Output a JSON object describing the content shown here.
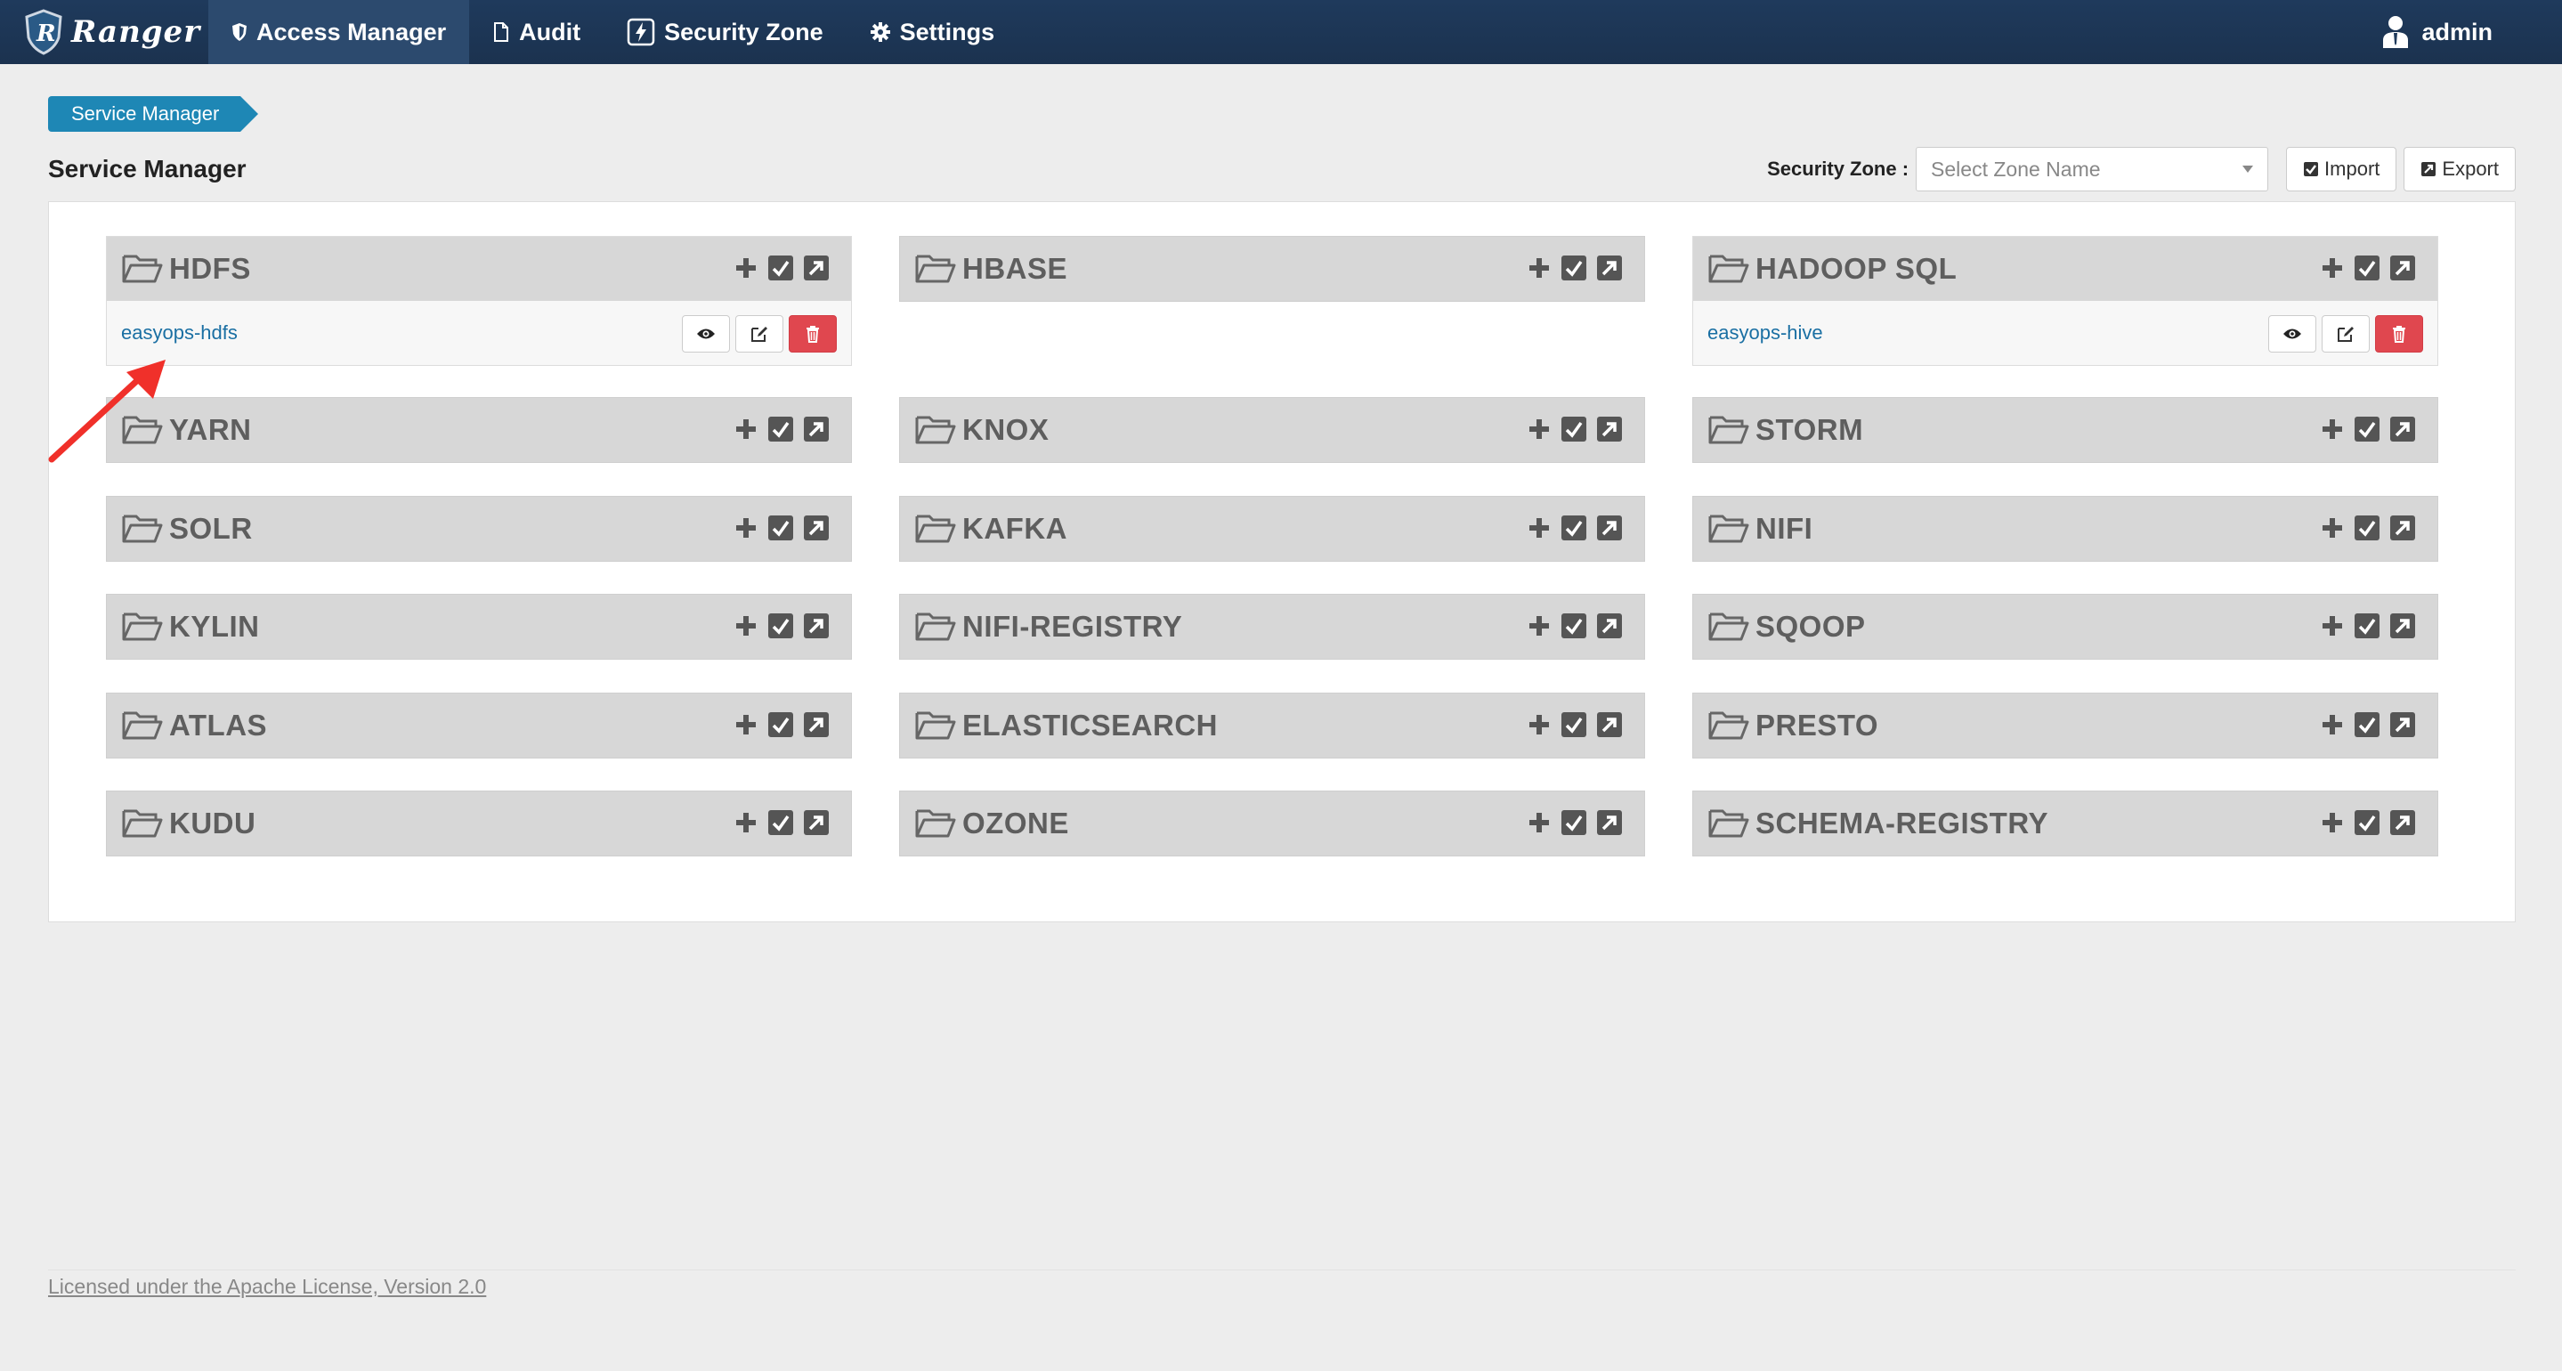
{
  "navbar": {
    "brand": "Ranger",
    "items": [
      {
        "label": "Access Manager",
        "icon": "shield-icon",
        "active": true
      },
      {
        "label": "Audit",
        "icon": "file-icon",
        "active": false
      },
      {
        "label": "Security Zone",
        "icon": "lightning-icon",
        "active": false
      },
      {
        "label": "Settings",
        "icon": "gear-icon",
        "active": false
      }
    ],
    "user": "admin"
  },
  "breadcrumb": [
    "Service Manager"
  ],
  "page": {
    "title": "Service Manager"
  },
  "toolbar": {
    "zone_label": "Security Zone :",
    "zone_placeholder": "Select Zone Name",
    "import_label": "Import",
    "export_label": "Export"
  },
  "services": [
    {
      "name": "HDFS",
      "items": [
        "easyops-hdfs"
      ]
    },
    {
      "name": "HBASE",
      "items": []
    },
    {
      "name": "HADOOP SQL",
      "items": [
        "easyops-hive"
      ]
    },
    {
      "name": "YARN",
      "items": []
    },
    {
      "name": "KNOX",
      "items": []
    },
    {
      "name": "STORM",
      "items": []
    },
    {
      "name": "SOLR",
      "items": []
    },
    {
      "name": "KAFKA",
      "items": []
    },
    {
      "name": "NIFI",
      "items": []
    },
    {
      "name": "KYLIN",
      "items": []
    },
    {
      "name": "NIFI-REGISTRY",
      "items": []
    },
    {
      "name": "SQOOP",
      "items": []
    },
    {
      "name": "ATLAS",
      "items": []
    },
    {
      "name": "ELASTICSEARCH",
      "items": []
    },
    {
      "name": "PRESTO",
      "items": []
    },
    {
      "name": "KUDU",
      "items": []
    },
    {
      "name": "OZONE",
      "items": []
    },
    {
      "name": "SCHEMA-REGISTRY",
      "items": []
    }
  ],
  "footer": {
    "license": "Licensed under the Apache License, Version 2.0"
  },
  "colors": {
    "navbar": "#1f3a5c",
    "accent": "#1e87b5",
    "link": "#1a6fa3",
    "danger": "#e0474f",
    "annotation_arrow": "#f0302a"
  }
}
